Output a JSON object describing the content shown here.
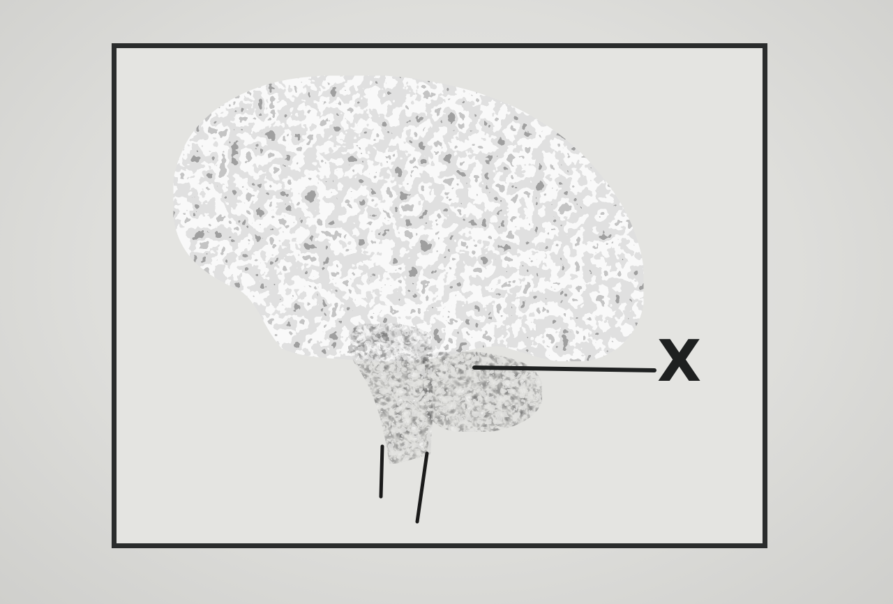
{
  "figure": {
    "labels": [
      {
        "id": "X",
        "text": "X",
        "points_to": "cerebellum"
      }
    ]
  }
}
